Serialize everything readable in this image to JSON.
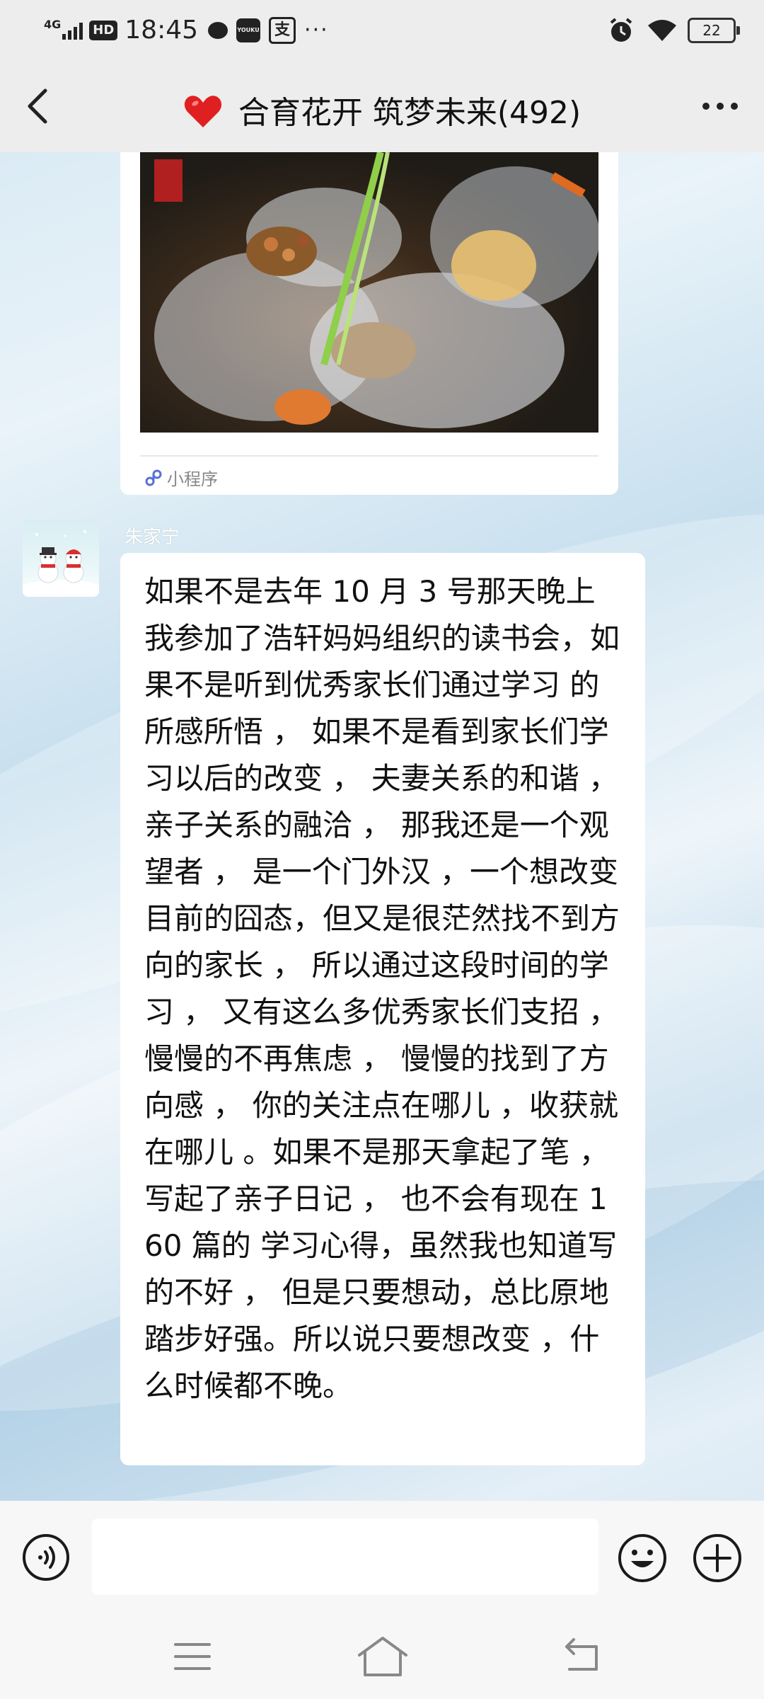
{
  "status_bar": {
    "network": "4G",
    "hd": "HD",
    "time": "18:45",
    "youku_label": "YOUKU",
    "zhi_label": "支",
    "more": "···",
    "battery": "22"
  },
  "header": {
    "title": "合育花开 筑梦未来(492)"
  },
  "mini_program_card": {
    "footer_label": "小程序"
  },
  "message": {
    "sender": "朱家宁",
    "text": "如果不是去年 10 月 3 号那天晚上我参加了浩轩妈妈组织的读书会，如果不是听到优秀家长们通过学习 的所感所悟 ， 如果不是看到家长们学习以后的改变 ， 夫妻关系的和谐 ， 亲子关系的融洽 ， 那我还是一个观望者 ， 是一个门外汉 ，一个想改变目前的囧态，但又是很茫然找不到方向的家长 ， 所以通过这段时间的学习 ， 又有这么多优秀家长们支招 ， 慢慢的不再焦虑 ， 慢慢的找到了方向感 ， 你的关注点在哪儿 ，收获就在哪儿 。如果不是那天拿起了笔 ， 写起了亲子日记 ， 也不会有现在 160 篇的 学习心得，虽然我也知道写的不好 ， 但是只要想动，总比原地踏步好强。所以说只要想改变 ，什么时候都不晚。"
  },
  "input_bar": {
    "placeholder": ""
  },
  "colors": {
    "header_bg": "#ededed",
    "bubble_bg": "#ffffff",
    "heart": "#e02020"
  }
}
